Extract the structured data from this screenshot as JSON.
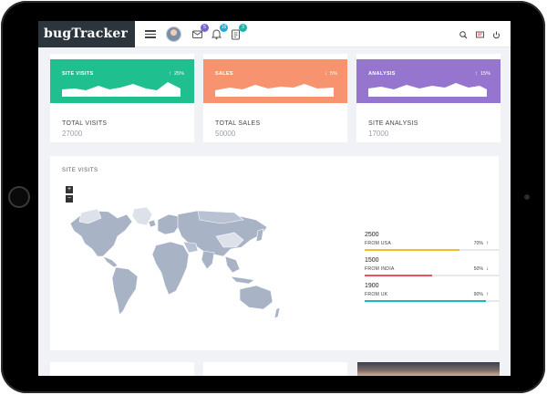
{
  "brand": {
    "name": "bugTracker"
  },
  "topbar": {
    "icons": [
      {
        "name": "notifications-icon",
        "badge": "5",
        "badge_color": "#7c63c7"
      },
      {
        "name": "messages-icon",
        "badge": "16",
        "badge_color": "#2aa7d6"
      },
      {
        "name": "tasks-icon",
        "badge": "3",
        "badge_color": "#20b2aa"
      }
    ],
    "right_icons": [
      "search-icon",
      "flag-icon",
      "power-icon"
    ]
  },
  "cards": [
    {
      "head": "SITE VISITS",
      "direction": "up",
      "pct": "25%",
      "color": "#1fbf8f",
      "label": "TOTAL VISITS",
      "value": "27000"
    },
    {
      "head": "SALES",
      "direction": "down",
      "pct": "5%",
      "color": "#f7946f",
      "label": "TOTAL SALES",
      "value": "50000"
    },
    {
      "head": "ANALYSIS",
      "direction": "up",
      "pct": "15%",
      "color": "#9575cd",
      "label": "SITE ANALYSIS",
      "value": "17000"
    }
  ],
  "site_visits": {
    "title": "SITE VISITS",
    "zoom_in": "+",
    "zoom_out": "−",
    "stats": [
      {
        "value": "2500",
        "label": "FROM USA",
        "pct": "70%",
        "direction": "up",
        "fill": 0.7,
        "color": "#f0bf2f"
      },
      {
        "value": "1500",
        "label": "FROM INDIA",
        "pct": "50%",
        "direction": "down",
        "fill": 0.5,
        "color": "#e9525e"
      },
      {
        "value": "1900",
        "label": "FROM UK",
        "pct": "90%",
        "direction": "up",
        "fill": 0.9,
        "color": "#1cb5b8"
      }
    ]
  },
  "arrows": {
    "up": "↑",
    "down": "↓"
  }
}
